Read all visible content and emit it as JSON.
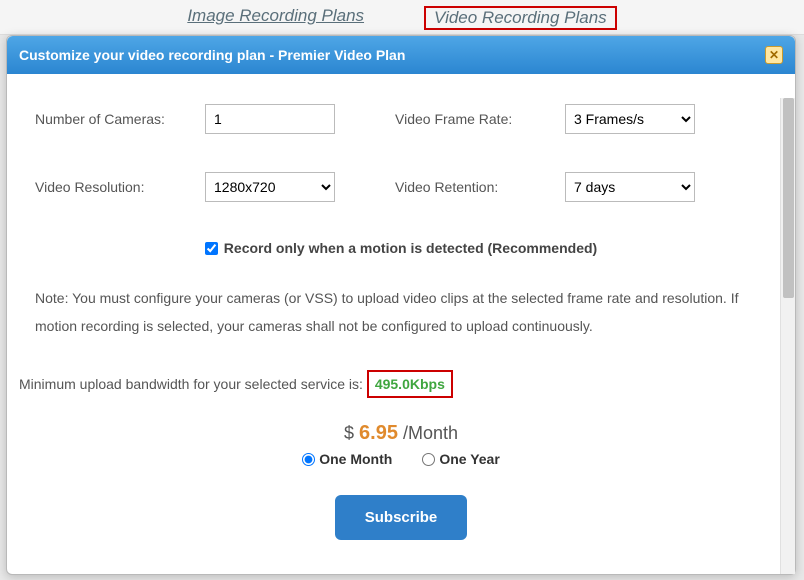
{
  "tabs": {
    "image": "Image Recording Plans",
    "video": "Video Recording Plans"
  },
  "dialog": {
    "title": "Customize your video recording plan - Premier Video Plan"
  },
  "form": {
    "num_cameras_label": "Number of Cameras:",
    "num_cameras_value": "1",
    "frame_rate_label": "Video Frame Rate:",
    "frame_rate_value": "3 Frames/s",
    "resolution_label": "Video Resolution:",
    "resolution_value": "1280x720",
    "retention_label": "Video Retention:",
    "retention_value": "7 days",
    "motion_checkbox_label": "Record only when a motion is detected (Recommended)",
    "motion_checked": true
  },
  "note": "Note: You must configure your cameras (or VSS) to upload video clips at the selected frame rate and resolution. If motion recording is selected, your cameras shall not be configured to upload continuously.",
  "bandwidth": {
    "label": "Minimum upload bandwidth for your selected service is:",
    "value": "495.0Kbps"
  },
  "price": {
    "currency": "$",
    "amount": "6.95",
    "period": "/Month"
  },
  "duration": {
    "one_month": "One Month",
    "one_year": "One Year",
    "selected": "one_month"
  },
  "subscribe_label": "Subscribe"
}
